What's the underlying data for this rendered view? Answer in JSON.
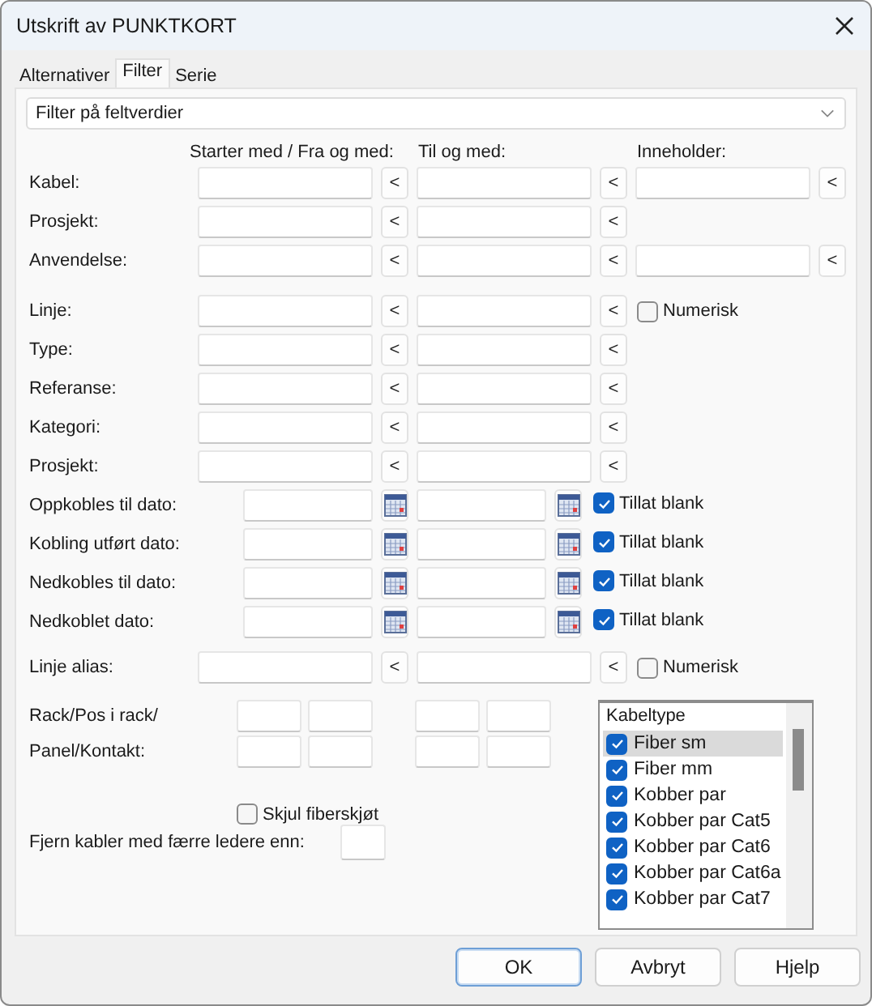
{
  "window": {
    "title": "Utskrift av PUNKTKORT"
  },
  "tabs": [
    {
      "label": "Alternativer",
      "selected": false
    },
    {
      "label": "Filter",
      "selected": true
    },
    {
      "label": "Serie",
      "selected": false
    }
  ],
  "filter_mode": {
    "value": "Filter på feltverdier"
  },
  "column_headers": [
    "Starter med / Fra og med:",
    "Til og med:",
    "Inneholder:"
  ],
  "groups": [
    [
      {
        "kind": "text",
        "label": "Kabel:",
        "buttons": [
          "<",
          "<",
          "<"
        ]
      },
      {
        "kind": "text",
        "label": "Prosjekt:",
        "buttons": [
          "<",
          "<"
        ]
      },
      {
        "kind": "text",
        "label": "Anvendelse:",
        "buttons": [
          "<",
          "<",
          "<"
        ]
      }
    ],
    [
      {
        "kind": "text",
        "label": "Linje:",
        "buttons": [
          "<",
          "<"
        ],
        "checkbox": {
          "label": "Numerisk",
          "checked": false
        }
      },
      {
        "kind": "text",
        "label": "Type:",
        "buttons": [
          "<",
          "<"
        ]
      },
      {
        "kind": "text",
        "label": "Referanse:",
        "buttons": [
          "<",
          "<"
        ]
      },
      {
        "kind": "text",
        "label": "Kategori:",
        "buttons": [
          "<",
          "<"
        ]
      },
      {
        "kind": "text",
        "label": "Prosjekt:",
        "buttons": [
          "<",
          "<"
        ]
      },
      {
        "kind": "date",
        "label": "Oppkobles til dato:",
        "checkbox": {
          "label": "Tillat blank",
          "checked": true
        }
      },
      {
        "kind": "date",
        "label": "Kobling utført dato:",
        "checkbox": {
          "label": "Tillat blank",
          "checked": true
        }
      },
      {
        "kind": "date",
        "label": "Nedkobles til dato:",
        "checkbox": {
          "label": "Tillat blank",
          "checked": true
        }
      },
      {
        "kind": "date",
        "label": "Nedkoblet dato:",
        "checkbox": {
          "label": "Tillat blank",
          "checked": true
        }
      }
    ],
    [
      {
        "kind": "text",
        "label": "Linje alias:",
        "buttons": [
          "<",
          "<"
        ],
        "checkbox": {
          "label": "Numerisk",
          "checked": false
        }
      }
    ]
  ],
  "rack_labels": [
    "Rack/Pos i rack/",
    "Panel/Kontakt:"
  ],
  "hide_splices": {
    "label": "Skjul fiberskjøt",
    "checked": false
  },
  "min_conductors": {
    "label": "Fjern kabler med færre ledere enn:"
  },
  "cable_types": {
    "header": "Kabeltype",
    "items": [
      {
        "label": "Fiber sm",
        "checked": true,
        "selected": true
      },
      {
        "label": "Fiber mm",
        "checked": true,
        "selected": false
      },
      {
        "label": "Kobber par",
        "checked": true,
        "selected": false
      },
      {
        "label": "Kobber par Cat5",
        "checked": true,
        "selected": false
      },
      {
        "label": "Kobber par Cat6",
        "checked": true,
        "selected": false
      },
      {
        "label": "Kobber par Cat6a",
        "checked": true,
        "selected": false
      },
      {
        "label": "Kobber par Cat7",
        "checked": true,
        "selected": false
      }
    ]
  },
  "buttons": [
    {
      "label": "OK",
      "default": true
    },
    {
      "label": "Avbryt",
      "default": false
    },
    {
      "label": "Hjelp",
      "default": false
    }
  ]
}
